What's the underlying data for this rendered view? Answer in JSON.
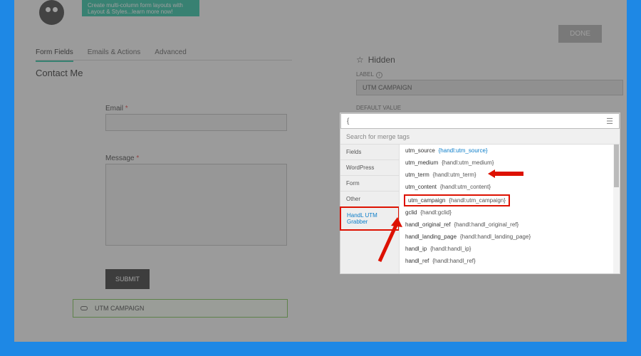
{
  "tip_text": "Create multi-column form layouts with Layout & Styles...learn more now!",
  "tabs": [
    "Form Fields",
    "Emails & Actions",
    "Advanced"
  ],
  "page_title": "Contact Me",
  "fields": {
    "email_label": "Email",
    "message_label": "Message"
  },
  "submit_label": "SUBMIT",
  "hidden_chip": "UTM CAMPAIGN",
  "done_label": "DONE",
  "right": {
    "heading": "Hidden",
    "label_caption": "LABEL",
    "label_value": "UTM CAMPAIGN",
    "default_caption": "DEFAULT VALUE",
    "brace": "{"
  },
  "merge": {
    "search_placeholder": "Search for merge tags",
    "categories": [
      "Fields",
      "WordPress",
      "Form",
      "Other",
      "HandL UTM Grabber"
    ],
    "items": [
      {
        "b": "utm_source",
        "p": "{handl:utm_source}"
      },
      {
        "b": "utm_medium",
        "p": "{handl:utm_medium}"
      },
      {
        "b": "utm_term",
        "p": "{handl:utm_term}"
      },
      {
        "b": "utm_content",
        "p": "{handl:utm_content}"
      },
      {
        "b": "utm_campaign",
        "p": "{handl:utm_campaign}"
      },
      {
        "b": "gclid",
        "p": "{handl:gclid}"
      },
      {
        "b": "handl_original_ref",
        "p": "{handl:handl_original_ref}"
      },
      {
        "b": "handl_landing_page",
        "p": "{handl:handl_landing_page}"
      },
      {
        "b": "handl_ip",
        "p": "{handl:handl_ip}"
      },
      {
        "b": "handl_ref",
        "p": "{handl:handl_ref}"
      }
    ]
  }
}
